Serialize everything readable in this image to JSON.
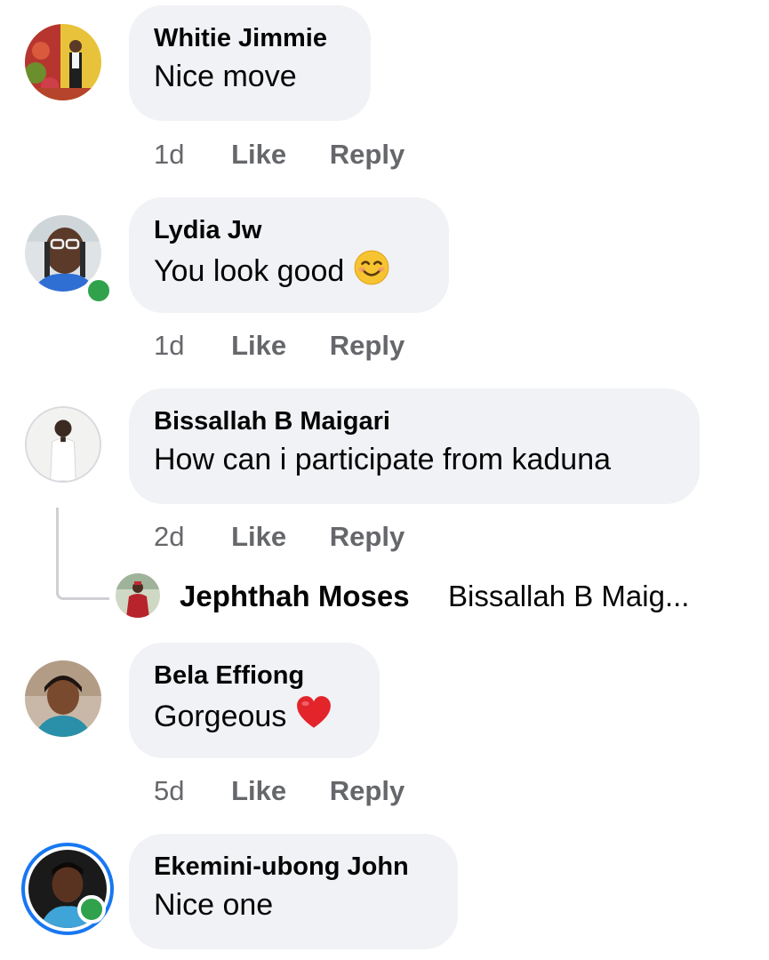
{
  "comments": [
    {
      "author": "Whitie Jimmie",
      "text": "Nice move",
      "time": "1d",
      "like": "Like",
      "reply": "Reply",
      "online": false,
      "emoji": ""
    },
    {
      "author": "Lydia Jw",
      "text": "You look good",
      "time": "1d",
      "like": "Like",
      "reply": "Reply",
      "online": true,
      "emoji": "smiling-face-emoji"
    },
    {
      "author": "Bissallah B Maigari",
      "text": "How can i participate from kaduna",
      "time": "2d",
      "like": "Like",
      "reply": "Reply",
      "online": false,
      "emoji": ""
    },
    {
      "author": "Bela Effiong",
      "text": "Gorgeous",
      "time": "5d",
      "like": "Like",
      "reply": "Reply",
      "online": false,
      "emoji": "red-heart-emoji"
    },
    {
      "author": "Ekemini-ubong John",
      "text": "Nice one",
      "online": true,
      "story_ring": true,
      "emoji": ""
    }
  ],
  "reply_preview": {
    "author": "Jephthah Moses",
    "text": "Bissallah B Maig..."
  },
  "colors": {
    "bubble": "#f0f2f5",
    "meta_text": "#65676b",
    "online": "#31a24c",
    "story_ring": "#1877f2"
  }
}
